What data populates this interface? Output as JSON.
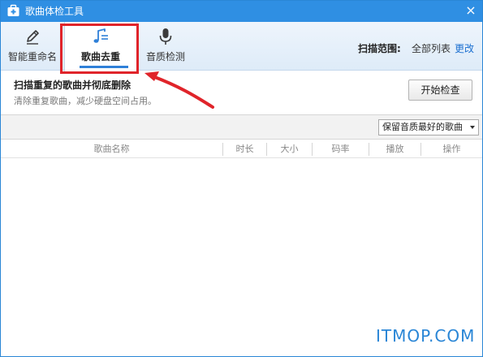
{
  "window": {
    "title": "歌曲体检工具",
    "close_glyph": "×",
    "title_icon": "toolbox-icon"
  },
  "tabs": [
    {
      "label": "智能重命名",
      "icon": "pen-icon",
      "active": false
    },
    {
      "label": "歌曲去重",
      "icon": "music-note-icon",
      "active": true
    },
    {
      "label": "音质检测",
      "icon": "microphone-icon",
      "active": false
    }
  ],
  "scan": {
    "label": "扫描范围:",
    "value": "全部列表",
    "change_link": "更改"
  },
  "description": {
    "title": "扫描重复的歌曲并彻底删除",
    "subtitle": "清除重复歌曲，减少硬盘空间占用。"
  },
  "start_button": "开始检查",
  "filter": {
    "selected": "保留音质最好的歌曲"
  },
  "table": {
    "columns": [
      "歌曲名称",
      "时长",
      "大小",
      "码率",
      "播放",
      "操作"
    ],
    "rows": []
  },
  "watermark": "ITMOP.COM",
  "colors": {
    "titlebar": "#2f8fe3",
    "accent": "#2f80d8",
    "highlight": "#e0242a",
    "link": "#1a6fd0"
  }
}
